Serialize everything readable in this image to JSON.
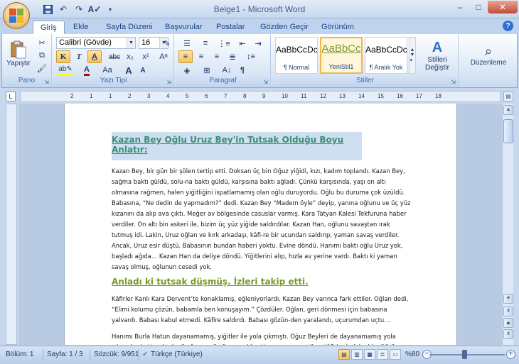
{
  "window": {
    "title": "Belge1 - Microsoft Word",
    "minimize": "–",
    "maximize": "□",
    "close": "✕"
  },
  "tabs": [
    "Giriş",
    "Ekle",
    "Sayfa Düzeni",
    "Başvurular",
    "Postalar",
    "Gözden Geçir",
    "Görünüm"
  ],
  "active_tab": "Giriş",
  "ribbon": {
    "clipboard": {
      "label": "Pano",
      "paste_label": "Yapıştır"
    },
    "font": {
      "label": "Yazı Tipi",
      "font_name": "Calibri (Gövde)",
      "font_size": "16",
      "bold": "K",
      "italic": "T",
      "underline": "A",
      "strike": "abc",
      "subscript": "x₂",
      "superscript": "x²",
      "font_color": "A",
      "change_case": "Aa",
      "grow": "A",
      "shrink": "A"
    },
    "paragraph": {
      "label": "Paragraf",
      "show_marks": "¶"
    },
    "styles": {
      "label": "Stiller",
      "items": [
        {
          "sample": "AaBbCcDc",
          "name": "¶ Normal"
        },
        {
          "sample": "AaBbCc",
          "name": "YeniStil1"
        },
        {
          "sample": "AaBbCcDc",
          "name": "¶ Aralık Yok"
        }
      ],
      "change_label": "Stilleri Değiştir"
    },
    "editing": {
      "label": "Düzenleme"
    }
  },
  "ruler": {
    "corner": "L",
    "ticks": [
      "2",
      "1",
      "1",
      "2",
      "3",
      "4",
      "5",
      "6",
      "7",
      "8",
      "9",
      "10",
      "11",
      "12",
      "13",
      "14",
      "15",
      "16",
      "17",
      "18"
    ]
  },
  "document": {
    "heading1": "Kazan Bey Oğlu Uruz Bey'in Tutsak Olduğu Boyu Anlatır:",
    "paragraph1": "Kazan Bey, bir gün bir şölen tertip etti. Doksan üç bin Oğuz yiğidi, kızı, kadım toplandı. Kazan Bey, sağma baktı güldü, solu-na baktı güldü, karşısına baktı ağladı. Çünkü karşısında, yaşı on altı olmasına rağmen, halen yiğitliğini ispatlamamış olan oğlu duruyordu. Oğlu bu duruma çok üzüldü. Babasına, “Ne dedin de yapmadım?” dedi. Kazan Bey “Madem öyle” deyip, yanına oğlunu ve üç yüz kızanını da alıp ava çıktı. Meğer av bölgesinde casuslar varmış. Kara Tatyan Kalesi Tekfuruna haber verdiler. On altı bin askeri ile, bizim üç yüz yiğide saldırdılar. Kazan Han, oğlunu savaştan ırak tutmuş idi. Lakin, Uruz oğlan ve kırk arkadaşı, kâfi-re bir ucundan saldırıp, yaman savaş verdiler. Ancak, Uruz esir düştü. Babasının bundan haberi yoktu. Evine döndü. Hanımı baktı oğlu Uruz yok, başladı ağıda… Kazan Han da deliye döndü. Yiğitlerini alıp, hızla av yerine vardı. Baktı ki yaman savaş olmuş, oğlunun cesedi yok.",
    "heading2": "Anladı ki tutsak düşmüş. İzleri takip etti.",
    "paragraph2": "Kâfirler Kanlı Kara Dervent’te konaklamış, eğleniyorlardı. Kazan Bey varınca fark ettiler. Oğlan dedi, “Elimi kolumu çözün, babamla ben konuşayım.” Çözdüler. Oğlan, geri dönmesi için babasına yalvardı. Babası kabul etmedi. Kâfire saldırdı. Babası gözün-den yaralandı, uçurumdan uçtu…",
    "paragraph3": "Hanımı Burla Hatun dayanamamış, yiğitler ile yola çıkmıştı. Oğuz Beyleri de dayanamamış yola çıkmışlardı. Hepsi tekmil gâvurun üstüne vardılar. Yaman savaş ettiler. Kâfirler helak oldu. Bütün malları Oğuz beylerinin eline geçti. Kazan Han, ölmemiş yoldaşlarına katılmıştı. Hep birlikte Uruz’u kurtardılar."
  },
  "status": {
    "section": "Bölüm: 1",
    "page": "Sayfa: 1 / 3",
    "words": "Sözcük: 9/951",
    "language": "Türkçe (Türkiye)",
    "zoom": "%80"
  },
  "colors": {
    "heading1": "#3d8f72",
    "heading2": "#7a9b2a",
    "accent": "#15428b"
  }
}
